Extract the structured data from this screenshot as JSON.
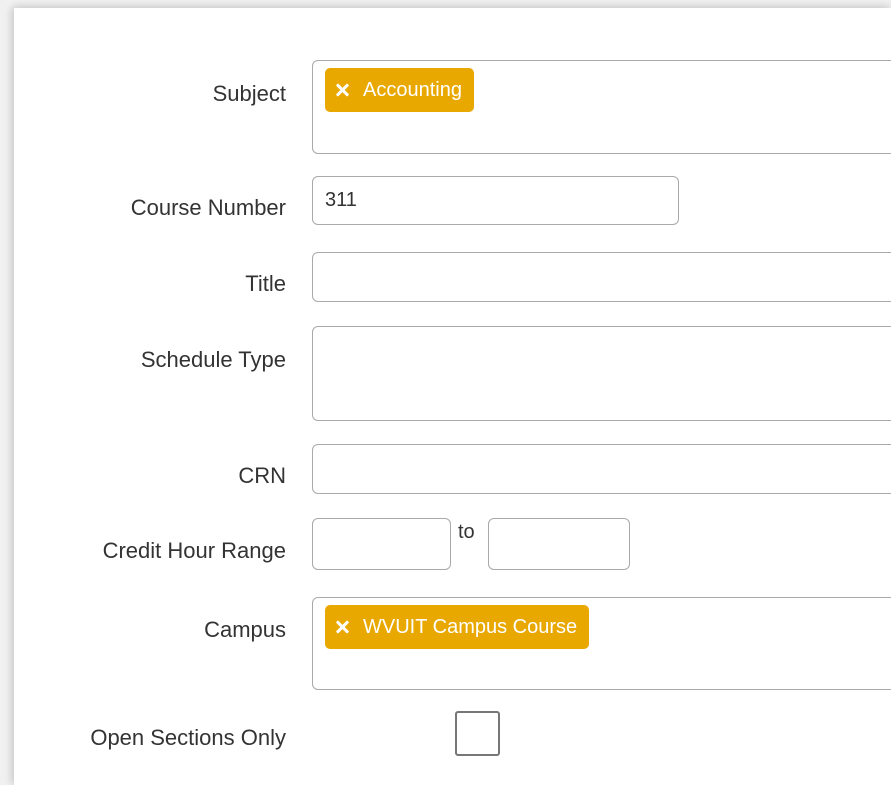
{
  "form": {
    "subject": {
      "label": "Subject",
      "tags": [
        "Accounting"
      ]
    },
    "course_number": {
      "label": "Course Number",
      "value": "311"
    },
    "title": {
      "label": "Title",
      "value": ""
    },
    "schedule_type": {
      "label": "Schedule Type",
      "tags": []
    },
    "crn": {
      "label": "CRN",
      "value": ""
    },
    "credit_hour_range": {
      "label": "Credit Hour Range",
      "from": "",
      "to_label": "to",
      "to": ""
    },
    "campus": {
      "label": "Campus",
      "tags": [
        "WVUIT Campus Course"
      ]
    },
    "open_sections_only": {
      "label": "Open Sections Only",
      "checked": false
    }
  },
  "colors": {
    "tag_background": "#e9a800",
    "tag_text": "#ffffff",
    "field_border": "#a9a9a9",
    "label_text": "#333333"
  },
  "icons": {
    "tag_remove": "close-x-icon"
  }
}
